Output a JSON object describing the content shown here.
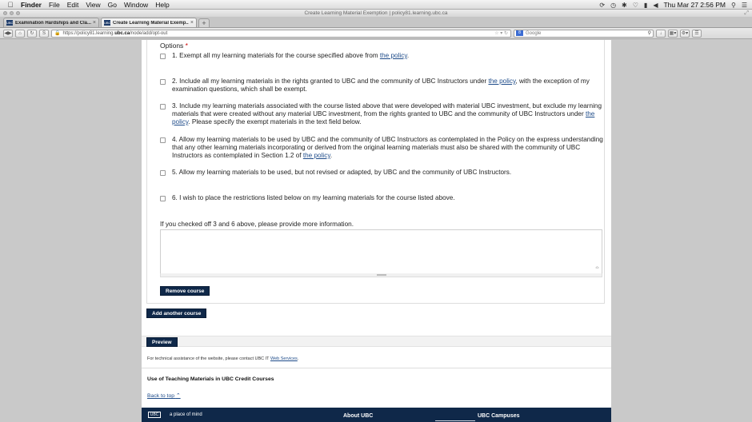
{
  "menubar": {
    "items": [
      "Finder",
      "File",
      "Edit",
      "View",
      "Go",
      "Window",
      "Help"
    ],
    "datetime": "Thu Mar 27  2:56 PM"
  },
  "window": {
    "title": "Create Learning Material Exemption | policy81.learning.ubc.ca"
  },
  "tabs": [
    {
      "label": "Examination Hardships and Cla..."
    },
    {
      "label": "Create Learning Material Exemp..."
    }
  ],
  "nav": {
    "url_prefix": "https://policy81.learning.",
    "url_host": "ubc.ca",
    "url_path": "/node/add/opt-out",
    "search_placeholder": "Google"
  },
  "form": {
    "options_label": "Options",
    "required_mark": "*",
    "policy_link": "the policy",
    "options": [
      {
        "pre": "1. Exempt all my learning materials for the course specified above from ",
        "post": "."
      },
      {
        "pre": "2. Include all my learning materials in the rights granted to UBC and the community of UBC Instructors under ",
        "post": ", with the exception of my examination questions, which shall be exempt."
      },
      {
        "pre": "3. Include my learning materials associated with the course listed above that were developed with material UBC investment, but exclude my learning materials that were created without any material UBC investment, from the rights granted to UBC and the community of UBC Instructors under ",
        "post": ". Please specify the exempt materials in the text field below."
      },
      {
        "pre": "4. Allow my learning materials to be used by UBC and the community of UBC Instructors as contemplated in the Policy on the express understanding that any other learning materials incorporating or derived from the original learning materials must also be shared with the community of UBC Instructors as contemplated in Section 1.2 of ",
        "post": "."
      },
      {
        "pre": "5. Allow my learning materials to be used, but not revised or adapted, by UBC and the community of UBC Instructors.",
        "post": ""
      },
      {
        "pre": "6. I wish to place the restrictions listed below on my learning materials for the course listed above.",
        "post": ""
      }
    ],
    "more_info_label": "If you checked off 3 and 6 above, please provide more information.",
    "more_info_value": "",
    "remove_course": "Remove course",
    "add_course": "Add another course",
    "preview": "Preview"
  },
  "footer": {
    "help_pre": "For technical assistance of the website, please contact UBC IT ",
    "help_link": "Web Services",
    "help_post": ".",
    "section_title": "Use of Teaching Materials in UBC Credit Courses",
    "back_to_top": "Back to top",
    "logo": "UBC",
    "tagline": "a place of mind",
    "about": "About UBC",
    "campuses": "UBC Campuses"
  }
}
